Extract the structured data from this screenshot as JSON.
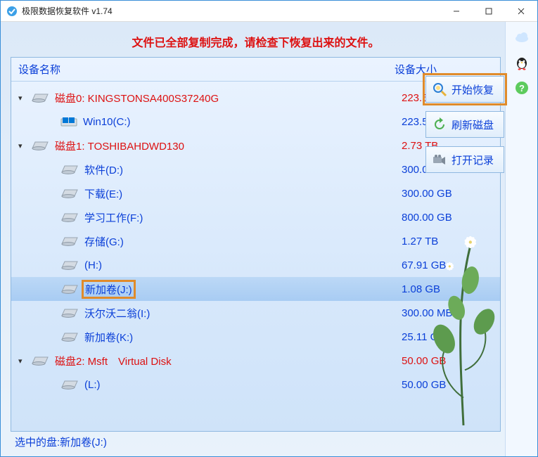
{
  "title": "极限数据恢复软件 v1.74",
  "banner": "文件已全部复制完成，请检查下恢复出来的文件。",
  "columns": {
    "name": "设备名称",
    "size": "设备大小"
  },
  "disks": [
    {
      "label": "磁盘0: KINGSTONSA400S37240G",
      "size": "223.57 GB",
      "expanded": true,
      "partitions": [
        {
          "label": "Win10(C:)",
          "size": "223.57 GB",
          "os": true
        }
      ]
    },
    {
      "label": "磁盘1: TOSHIBAHDWD130",
      "size": "2.73 TB",
      "expanded": true,
      "partitions": [
        {
          "label": "软件(D:)",
          "size": "300.00 GB"
        },
        {
          "label": "下载(E:)",
          "size": "300.00 GB"
        },
        {
          "label": "学习工作(F:)",
          "size": "800.00 GB"
        },
        {
          "label": "存储(G:)",
          "size": "1.27 TB"
        },
        {
          "label": "(H:)",
          "size": "67.91 GB"
        },
        {
          "label": "新加卷(J:)",
          "size": "1.08 GB",
          "selected": true,
          "highlighted": true
        },
        {
          "label": "沃尔沃二翁(I:)",
          "size": "300.00 MB"
        },
        {
          "label": "新加卷(K:)",
          "size": "25.11 GB"
        }
      ]
    },
    {
      "label": "磁盘2: Msft Virtual Disk",
      "size": "50.00 GB",
      "expanded": true,
      "redsize": true,
      "partitions": [
        {
          "label": "(L:)",
          "size": "50.00 GB"
        }
      ]
    }
  ],
  "status": "选中的盘:新加卷(J:)",
  "buttons": {
    "start": "开始恢复",
    "refresh": "刷新磁盘",
    "open": "打开记录"
  }
}
